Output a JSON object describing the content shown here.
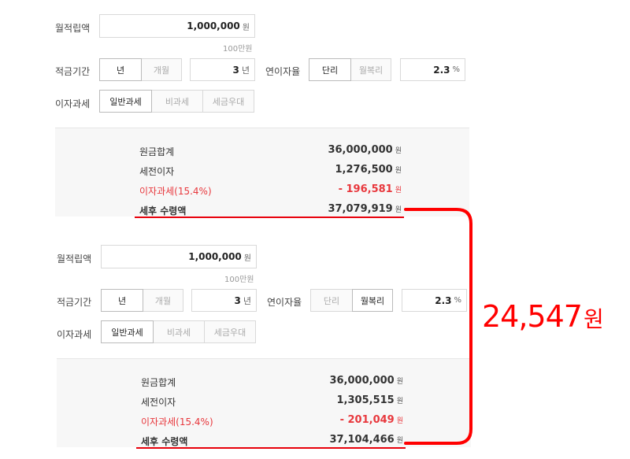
{
  "calc1": {
    "monthly_label": "월적립액",
    "monthly_value": "1,000,000",
    "monthly_unit": "원",
    "monthly_hint": "100만원",
    "period_label": "적금기간",
    "period_opt_year": "년",
    "period_opt_month": "개월",
    "period_value": "3",
    "period_unit": "년",
    "rate_label": "연이자율",
    "rate_opt_simple": "단리",
    "rate_opt_compound": "월복리",
    "rate_value": "2.3",
    "rate_unit": "%",
    "tax_label": "이자과세",
    "tax_opt_general": "일반과세",
    "tax_opt_none": "비과세",
    "tax_opt_favored": "세금우대",
    "selected_rate_type": "단리",
    "results": {
      "principal_label": "원금합계",
      "principal_value": "36,000,000",
      "interest_label": "세전이자",
      "interest_value": "1,276,500",
      "tax_label": "이자과세(15.4%)",
      "tax_value": "- 196,581",
      "net_label": "세후 수령액",
      "net_value": "37,079,919",
      "unit": "원"
    }
  },
  "calc2": {
    "monthly_label": "월적립액",
    "monthly_value": "1,000,000",
    "monthly_unit": "원",
    "monthly_hint": "100만원",
    "period_label": "적금기간",
    "period_opt_year": "년",
    "period_opt_month": "개월",
    "period_value": "3",
    "period_unit": "년",
    "rate_label": "연이자율",
    "rate_opt_simple": "단리",
    "rate_opt_compound": "월복리",
    "rate_value": "2.3",
    "rate_unit": "%",
    "tax_label": "이자과세",
    "tax_opt_general": "일반과세",
    "tax_opt_none": "비과세",
    "tax_opt_favored": "세금우대",
    "selected_rate_type": "월복리",
    "results": {
      "principal_label": "원금합계",
      "principal_value": "36,000,000",
      "interest_label": "세전이자",
      "interest_value": "1,305,515",
      "tax_label": "이자과세(15.4%)",
      "tax_value": "- 201,049",
      "net_label": "세후 수령액",
      "net_value": "37,104,466",
      "unit": "원"
    }
  },
  "annotation": {
    "difference_value": "24,547",
    "difference_unit": "원",
    "color": "#ff0000"
  }
}
